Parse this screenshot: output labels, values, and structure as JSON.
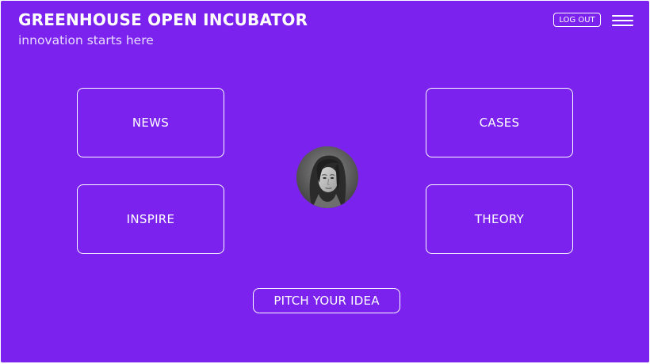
{
  "header": {
    "title": "GREENHOUSE OPEN INCUBATOR",
    "tagline": "innovation starts here",
    "logout_label": "LOG OUT",
    "menu_icon": "hamburger-menu-icon"
  },
  "tiles": {
    "news": "NEWS",
    "cases": "CASES",
    "inspire": "INSPIRE",
    "theory": "THEORY"
  },
  "cta": {
    "pitch_label": "PITCH YOUR IDEA"
  },
  "colors": {
    "background": "#7b22ef",
    "foreground": "#ffffff"
  }
}
